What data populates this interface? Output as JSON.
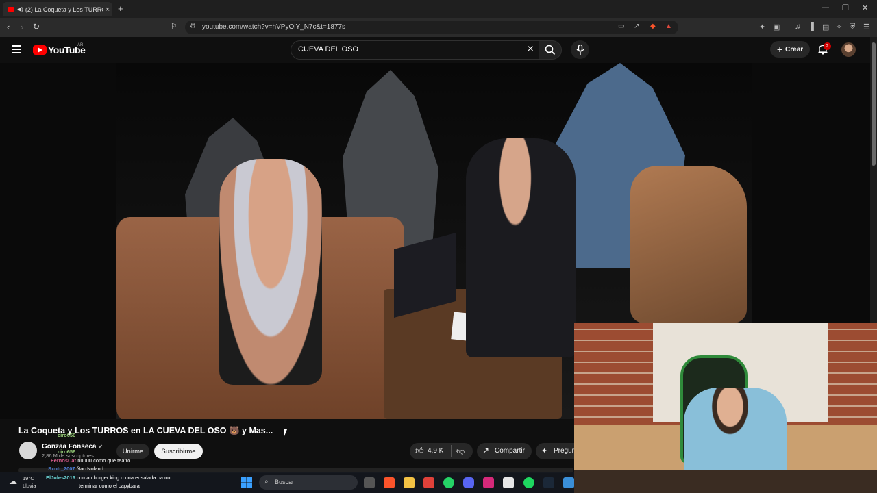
{
  "browser": {
    "tab_title": "(2) La Coqueta y Los TURROS",
    "url": "youtube.com/watch?v=hVPyOiY_N7c&t=1877s"
  },
  "youtube": {
    "logo_text": "YouTube",
    "region": "AR",
    "search_query": "CUEVA DEL OSO",
    "create_label": "Crear",
    "notifications": "2"
  },
  "video": {
    "title": "La Coqueta y Los TURROS en LA CUEVA DEL OSO 🐻 y Mas...",
    "channel": "Gonzaa Fonseca",
    "subscribers": "2,86 M de suscriptores",
    "join_label": "Unirme",
    "subscribe_label": "Suscribirme",
    "likes": "4,9 K",
    "share_label": "Compartir",
    "ask_label": "Pregun"
  },
  "chat": [
    {
      "user": "ciro656",
      "text": ""
    },
    {
      "user": "ciro656",
      "text": ""
    },
    {
      "user": "FernosCat",
      "text": "nuuuu como que teatro"
    },
    {
      "user": "Sxott_2007",
      "text": "Ñac Noland"
    },
    {
      "user": "ElJules2019",
      "text": "coman burger king o una ensalada pa no"
    },
    {
      "user": "",
      "text": "terminar como el capybara"
    }
  ],
  "taskbar": {
    "temp": "19°C",
    "weather": "Lluvia",
    "search_placeholder": "Buscar"
  }
}
